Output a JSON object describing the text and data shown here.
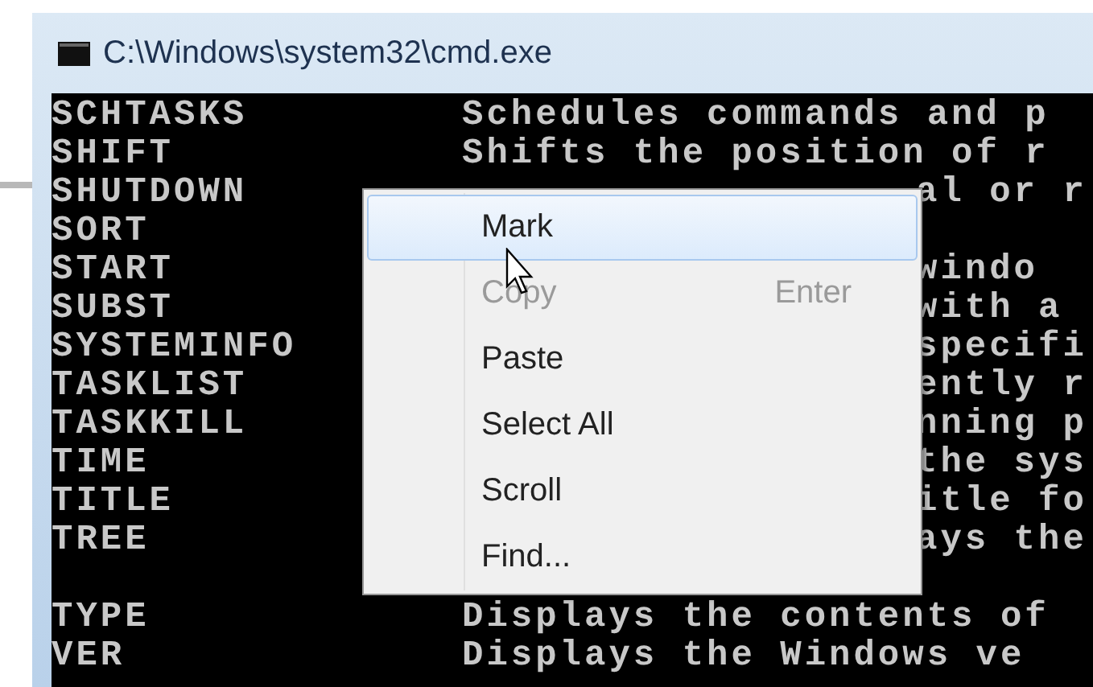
{
  "window": {
    "title": "C:\\Windows\\system32\\cmd.exe"
  },
  "console": {
    "lines": [
      {
        "command": "SCHTASKS",
        "description": "Schedules commands and p",
        "kind": "full"
      },
      {
        "command": "SHIFT",
        "description": "Shifts the position of r",
        "kind": "full"
      },
      {
        "command": "SHUTDOWN",
        "description": "al or r",
        "kind": "clipped"
      },
      {
        "command": "SORT",
        "kind": "clipped"
      },
      {
        "command": "START",
        "description": "windo",
        "kind": "clipped"
      },
      {
        "command": "SUBST",
        "description": "with a",
        "kind": "clipped"
      },
      {
        "command": "SYSTEMINFO",
        "description": "specifi",
        "kind": "clipped"
      },
      {
        "command": "TASKLIST",
        "description": "ently r",
        "kind": "clipped"
      },
      {
        "command": "TASKKILL",
        "description": "nning p",
        "kind": "clipped"
      },
      {
        "command": "TIME",
        "description": "the sys",
        "kind": "clipped"
      },
      {
        "command": "TITLE",
        "description": "itle fo",
        "kind": "clipped"
      },
      {
        "command": "TREE",
        "description": "ays the",
        "kind": "clipped"
      },
      {
        "kind": "blank"
      },
      {
        "command": "TYPE",
        "description": "Displays the contents of",
        "kind": "full"
      },
      {
        "command": "VER",
        "description": "Displays the Windows ve",
        "kind": "full"
      }
    ]
  },
  "context_menu": {
    "items": [
      {
        "label": "Mark",
        "selected": true,
        "disabled": false
      },
      {
        "label": "Copy",
        "shortcut": "Enter",
        "selected": false,
        "disabled": true
      },
      {
        "label": "Paste",
        "selected": false,
        "disabled": false
      },
      {
        "label": "Select All",
        "selected": false,
        "disabled": false
      },
      {
        "label": "Scroll",
        "selected": false,
        "disabled": false
      },
      {
        "label": "Find...",
        "selected": false,
        "disabled": false
      }
    ]
  }
}
